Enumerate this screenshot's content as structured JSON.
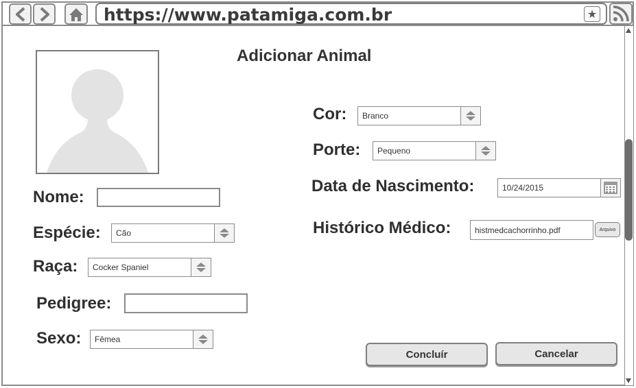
{
  "browser": {
    "url": "https://www.patamiga.com.br",
    "back_label": "<",
    "forward_label": ">"
  },
  "page": {
    "title": "Adicionar Animal"
  },
  "form": {
    "nome": {
      "label": "Nome:",
      "value": ""
    },
    "especie": {
      "label": "Espécie:",
      "value": "Cão"
    },
    "raca": {
      "label": "Raça:",
      "value": "Cocker Spaniel"
    },
    "pedigree": {
      "label": "Pedigree:",
      "value": ""
    },
    "sexo": {
      "label": "Sexo:",
      "value": "Fêmea"
    },
    "cor": {
      "label": "Cor:",
      "value": "Branco"
    },
    "porte": {
      "label": "Porte:",
      "value": "Pequeno"
    },
    "data_nascimento": {
      "label": "Data de Nascimento:",
      "value": "10/24/2015"
    },
    "historico": {
      "label": "Histórico Médico:",
      "value": "histmedcachorrinho.pdf",
      "button": "Arquivo"
    }
  },
  "actions": {
    "concluir": "Concluír",
    "cancelar": "Cancelar"
  },
  "icons": {
    "back": "chevron-left-icon",
    "forward": "chevron-right-icon",
    "home": "home-icon",
    "bookmark": "star-icon",
    "rss": "rss-icon",
    "calendar": "calendar-icon",
    "avatar": "user-placeholder-icon"
  }
}
